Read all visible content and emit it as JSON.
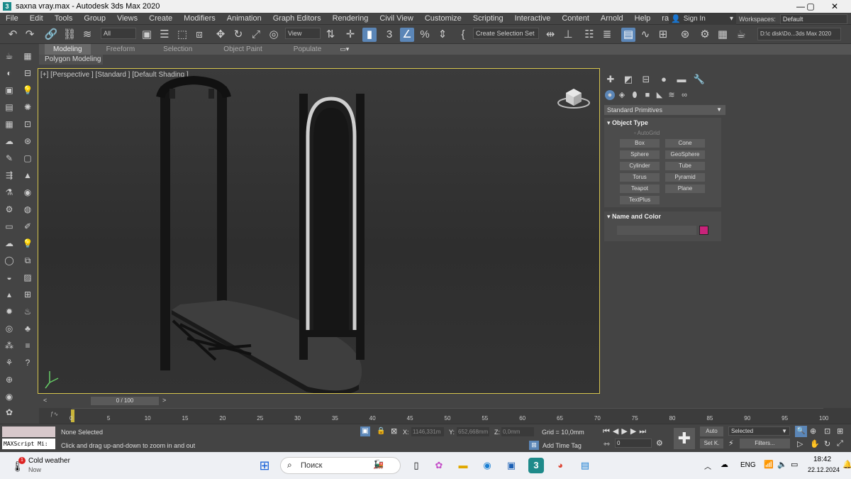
{
  "title_bar": {
    "title": "saxna vray.max - Autodesk 3ds Max 2020",
    "app_icon": "3",
    "minimize": "—",
    "maximize": "▢",
    "close": "✕"
  },
  "menu": [
    "File",
    "Edit",
    "Tools",
    "Group",
    "Views",
    "Create",
    "Modifiers",
    "Animation",
    "Graph Editors",
    "Rendering",
    "Civil View",
    "Customize",
    "Scripting",
    "Interactive",
    "Content",
    "Arnold",
    "Help",
    "rapidTools"
  ],
  "account": {
    "sign_in": "Sign In",
    "workspaces_label": "Workspaces:",
    "workspace_value": "Default"
  },
  "toolbar": {
    "filter_value": "All",
    "coord_value": "View",
    "selection_set": "Create Selection Set",
    "project_path": "D:\\c disk\\Do...3ds Max 2020"
  },
  "ribbon": {
    "tabs": [
      "Modeling",
      "Freeform",
      "Selection",
      "Object Paint",
      "Populate"
    ],
    "active_tab": "Modeling",
    "sub_label": "Polygon Modeling"
  },
  "viewport": {
    "label": "[+] [Perspective ] [Standard ] [Default Shading ]"
  },
  "command_panel": {
    "category": "Standard Primitives",
    "object_type_title": "Object Type",
    "autogrid": "AutoGrid",
    "buttons": [
      "Box",
      "Cone",
      "Sphere",
      "GeoSphere",
      "Cylinder",
      "Tube",
      "Torus",
      "Pyramid",
      "Teapot",
      "Plane",
      "TextPlus"
    ],
    "name_color_title": "Name and Color",
    "swatch_color": "#c8237a"
  },
  "timeline": {
    "slider_label": "0 / 100",
    "ticks": [
      "0",
      "5",
      "10",
      "15",
      "20",
      "25",
      "30",
      "35",
      "40",
      "45",
      "50",
      "55",
      "60",
      "65",
      "70",
      "75",
      "80",
      "85",
      "90",
      "95",
      "100"
    ]
  },
  "status": {
    "maxscript_placeholder": "MAXScript Mi:",
    "selection": "None Selected",
    "prompt": "Click and drag up-and-down to zoom in and out",
    "x_label": "X:",
    "x_value": "1146,331m",
    "y_label": "Y:",
    "y_value": "652,668mm",
    "z_label": "Z:",
    "z_value": "0,0mm",
    "grid": "Grid = 10,0mm",
    "add_time_tag": "Add Time Tag",
    "auto": "Auto",
    "set_key": "Set K.",
    "selected_dropdown": "Selected",
    "filters": "Filters...",
    "frame_value": "0"
  },
  "taskbar": {
    "weather_title": "Cold weather",
    "weather_sub": "Now",
    "weather_badge": "1",
    "search_placeholder": "Поиск",
    "lang": "ENG",
    "time": "18:42",
    "date": "22.12.2024"
  }
}
